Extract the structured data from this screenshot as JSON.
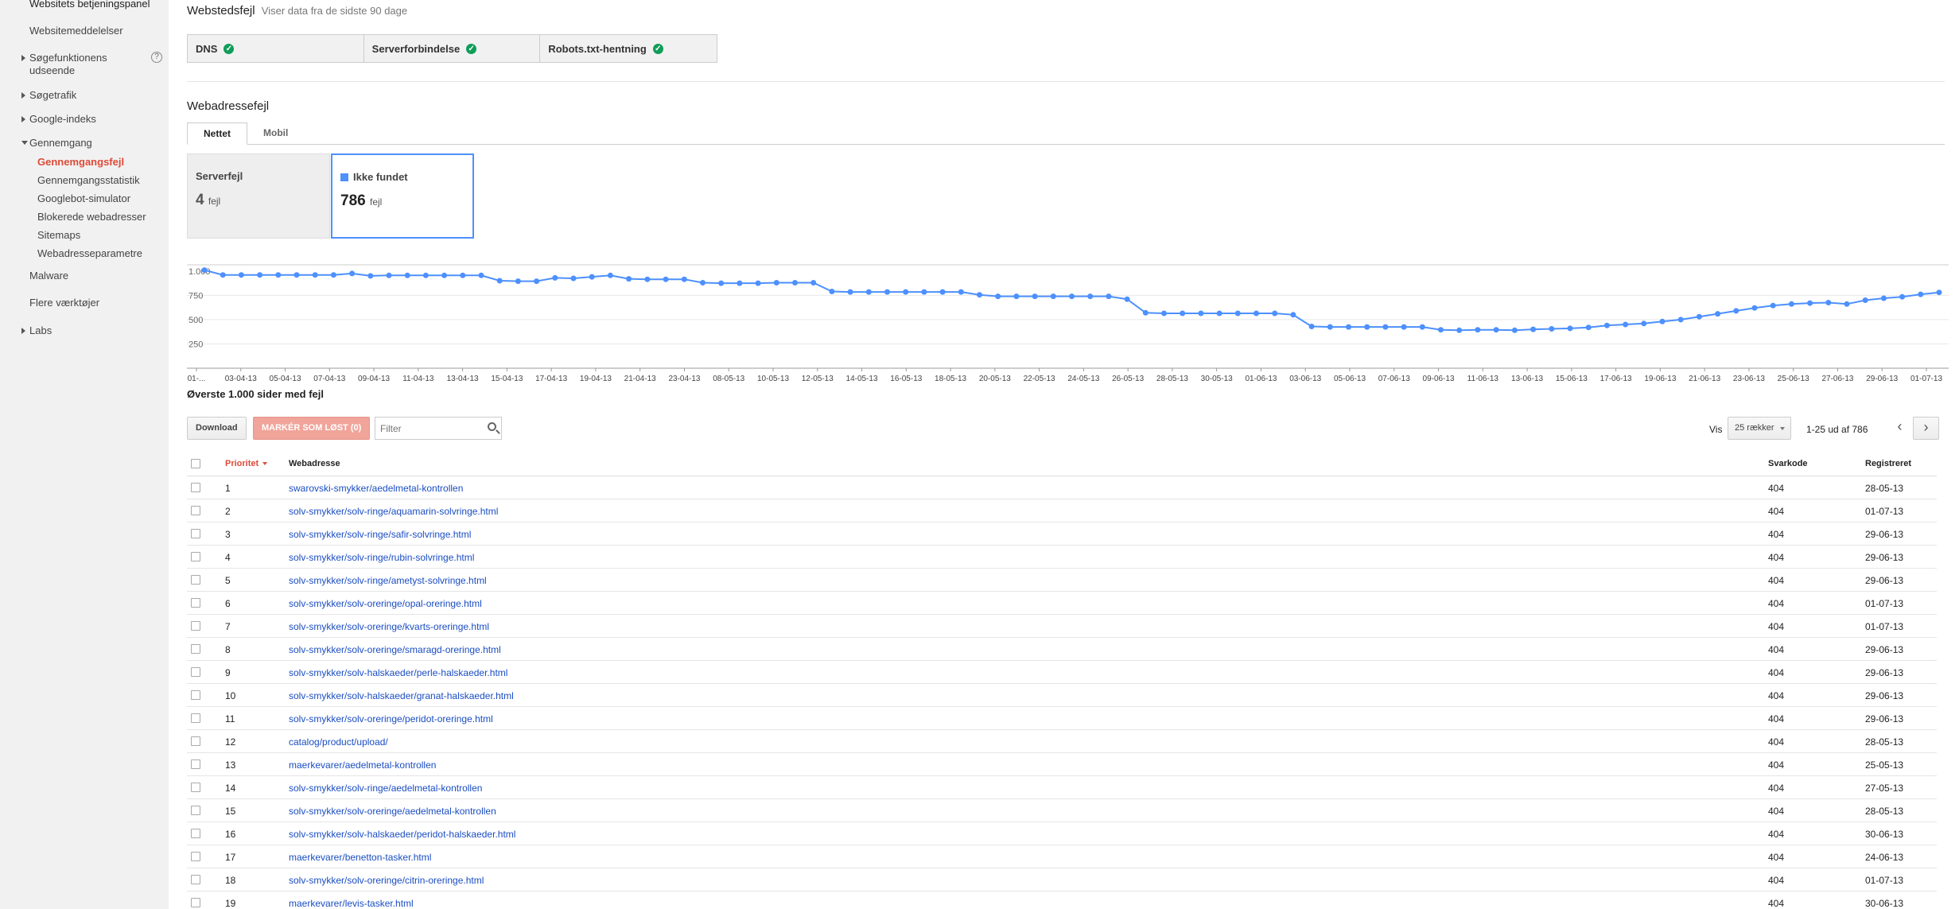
{
  "sidebar": {
    "top_item": "Websitets betjeningspanel",
    "items": [
      {
        "label": "Websitemeddelelser"
      },
      {
        "label": "Søgefunktionens udseende"
      },
      {
        "label": "Søgetrafik"
      },
      {
        "label": "Google-indeks"
      },
      {
        "label": "Gennemgang"
      },
      {
        "label": "Malware"
      },
      {
        "label": "Flere værktøjer"
      },
      {
        "label": "Labs"
      }
    ],
    "sub_items": [
      {
        "label": "Gennemgangsfejl"
      },
      {
        "label": "Gennemgangsstatistik"
      },
      {
        "label": "Googlebot-simulator"
      },
      {
        "label": "Blokerede webadresser"
      },
      {
        "label": "Sitemaps"
      },
      {
        "label": "Webadresseparametre"
      }
    ],
    "help_label": "?"
  },
  "site_errors": {
    "title": "Webstedsfejl",
    "subtitle": "Viser data fra de sidste 90 dage",
    "checks": [
      {
        "label": "DNS"
      },
      {
        "label": "Serverforbindelse"
      },
      {
        "label": "Robots.txt-hentning"
      }
    ]
  },
  "url_errors": {
    "title": "Webadressefejl",
    "tabs": [
      {
        "label": "Nettet"
      },
      {
        "label": "Mobil"
      }
    ],
    "cards": [
      {
        "label": "Serverfejl",
        "count": "4",
        "unit": "fejl"
      },
      {
        "label": "Ikke fundet",
        "count": "786",
        "unit": "fejl"
      }
    ]
  },
  "chart_data": {
    "type": "line",
    "series": [
      {
        "name": "Ikke fundet",
        "color": "#4d90fe"
      }
    ],
    "ylim": [
      0,
      1000
    ],
    "yticks": [
      "1.000",
      "750",
      "500",
      "250"
    ],
    "xticks": [
      "01-...",
      "03-04-13",
      "05-04-13",
      "07-04-13",
      "09-04-13",
      "11-04-13",
      "13-04-13",
      "15-04-13",
      "17-04-13",
      "19-04-13",
      "21-04-13",
      "23-04-13",
      "08-05-13",
      "10-05-13",
      "12-05-13",
      "14-05-13",
      "16-05-13",
      "18-05-13",
      "20-05-13",
      "22-05-13",
      "24-05-13",
      "26-05-13",
      "28-05-13",
      "30-05-13",
      "01-06-13",
      "03-06-13",
      "05-06-13",
      "07-06-13",
      "09-06-13",
      "11-06-13",
      "13-06-13",
      "15-06-13",
      "17-06-13",
      "19-06-13",
      "21-06-13",
      "23-06-13",
      "25-06-13",
      "27-06-13",
      "29-06-13",
      "01-07-13"
    ],
    "values": [
      1010,
      960,
      960,
      960,
      960,
      960,
      960,
      960,
      975,
      950,
      955,
      955,
      955,
      955,
      955,
      955,
      900,
      895,
      895,
      930,
      925,
      940,
      955,
      920,
      915,
      915,
      915,
      880,
      875,
      875,
      875,
      880,
      880,
      880,
      790,
      785,
      785,
      785,
      785,
      785,
      785,
      785,
      755,
      740,
      740,
      740,
      740,
      740,
      740,
      740,
      710,
      570,
      565,
      565,
      565,
      565,
      565,
      565,
      565,
      550,
      430,
      425,
      425,
      425,
      425,
      425,
      425,
      395,
      390,
      395,
      395,
      390,
      400,
      405,
      410,
      420,
      440,
      450,
      460,
      480,
      500,
      530,
      560,
      590,
      620,
      645,
      660,
      670,
      675,
      660,
      700,
      720,
      735,
      760,
      780
    ],
    "caption": "Øverste 1.000 sider med fejl"
  },
  "toolbar": {
    "download": "Download",
    "mark_fixed": "MARKÉR SOM LØST (0)",
    "filter_placeholder": "Filter",
    "show_label": "Vis",
    "rows_select": "25 rækker",
    "range": "1-25 ud af 786",
    "prev": "‹",
    "next": "›"
  },
  "table": {
    "headers": {
      "priority": "Prioritet",
      "url": "Webadresse",
      "code": "Svarkode",
      "date": "Registreret"
    },
    "rows": [
      {
        "p": "1",
        "url": "swarovski-smykker/aedelmetal-kontrollen",
        "code": "404",
        "date": "28-05-13"
      },
      {
        "p": "2",
        "url": "solv-smykker/solv-ringe/aquamarin-solvringe.html",
        "code": "404",
        "date": "01-07-13"
      },
      {
        "p": "3",
        "url": "solv-smykker/solv-ringe/safir-solvringe.html",
        "code": "404",
        "date": "29-06-13"
      },
      {
        "p": "4",
        "url": "solv-smykker/solv-ringe/rubin-solvringe.html",
        "code": "404",
        "date": "29-06-13"
      },
      {
        "p": "5",
        "url": "solv-smykker/solv-ringe/ametyst-solvringe.html",
        "code": "404",
        "date": "29-06-13"
      },
      {
        "p": "6",
        "url": "solv-smykker/solv-oreringe/opal-oreringe.html",
        "code": "404",
        "date": "01-07-13"
      },
      {
        "p": "7",
        "url": "solv-smykker/solv-oreringe/kvarts-oreringe.html",
        "code": "404",
        "date": "01-07-13"
      },
      {
        "p": "8",
        "url": "solv-smykker/solv-oreringe/smaragd-oreringe.html",
        "code": "404",
        "date": "29-06-13"
      },
      {
        "p": "9",
        "url": "solv-smykker/solv-halskaeder/perle-halskaeder.html",
        "code": "404",
        "date": "29-06-13"
      },
      {
        "p": "10",
        "url": "solv-smykker/solv-halskaeder/granat-halskaeder.html",
        "code": "404",
        "date": "29-06-13"
      },
      {
        "p": "11",
        "url": "solv-smykker/solv-oreringe/peridot-oreringe.html",
        "code": "404",
        "date": "29-06-13"
      },
      {
        "p": "12",
        "url": "catalog/product/upload/",
        "code": "404",
        "date": "28-05-13"
      },
      {
        "p": "13",
        "url": "maerkevarer/aedelmetal-kontrollen",
        "code": "404",
        "date": "25-05-13"
      },
      {
        "p": "14",
        "url": "solv-smykker/solv-ringe/aedelmetal-kontrollen",
        "code": "404",
        "date": "27-05-13"
      },
      {
        "p": "15",
        "url": "solv-smykker/solv-oreringe/aedelmetal-kontrollen",
        "code": "404",
        "date": "28-05-13"
      },
      {
        "p": "16",
        "url": "solv-smykker/solv-halskaeder/peridot-halskaeder.html",
        "code": "404",
        "date": "30-06-13"
      },
      {
        "p": "17",
        "url": "maerkevarer/benetton-tasker.html",
        "code": "404",
        "date": "24-06-13"
      },
      {
        "p": "18",
        "url": "solv-smykker/solv-oreringe/citrin-oreringe.html",
        "code": "404",
        "date": "01-07-13"
      },
      {
        "p": "19",
        "url": "maerkevarer/levis-tasker.html",
        "code": "404",
        "date": "30-06-13"
      }
    ]
  }
}
